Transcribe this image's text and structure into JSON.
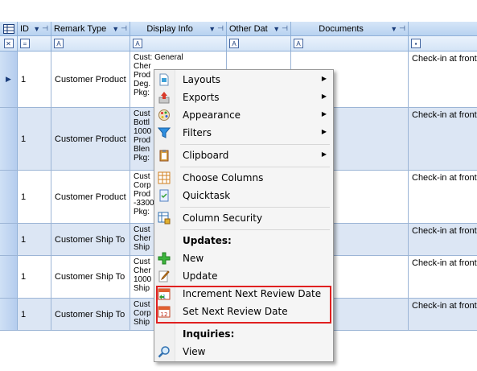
{
  "columns": {
    "id": "ID",
    "remark_type": "Remark Type",
    "display_info": "Display Info",
    "other_data": "Other Dat",
    "documents": "Documents"
  },
  "filter_row": {
    "id_op": "=",
    "text_icon": "A"
  },
  "rows": [
    {
      "id": "1",
      "remark_type": "Customer Product",
      "display": [
        "Cust: General",
        "Cher",
        "Prod",
        "Deg.",
        "Pkg:"
      ],
      "note": "Check-in at front"
    },
    {
      "id": "1",
      "remark_type": "Customer Product",
      "display": [
        "Cust",
        "Bottl",
        "1000",
        "Prod",
        "Blen",
        "Pkg:"
      ],
      "note": "Check-in at front"
    },
    {
      "id": "1",
      "remark_type": "Customer Product",
      "display": [
        "Cust",
        "Corp",
        "Prod",
        "-3300",
        "Pkg:"
      ],
      "note": "Check-in at front"
    },
    {
      "id": "1",
      "remark_type": "Customer Ship To",
      "display": [
        "Cust",
        "Cher",
        "Ship"
      ],
      "note": "Check-in at front"
    },
    {
      "id": "1",
      "remark_type": "Customer Ship To",
      "display": [
        "Cust",
        "Cher",
        "1000",
        "Ship"
      ],
      "note": "Check-in at front"
    },
    {
      "id": "1",
      "remark_type": "Customer Ship To",
      "display": [
        "Cust",
        "Corp",
        "Ship"
      ],
      "note": "Check-in at front"
    }
  ],
  "context_menu": {
    "layouts": "Layouts",
    "exports": "Exports",
    "appearance": "Appearance",
    "filters": "Filters",
    "clipboard": "Clipboard",
    "choose_columns": "Choose Columns",
    "quicktask": "Quicktask",
    "column_security": "Column Security",
    "updates_header": "Updates:",
    "new": "New",
    "update": "Update",
    "increment_next_review": "Increment Next Review Date",
    "set_next_review": "Set Next Review Date",
    "inquiries_header": "Inquiries:",
    "view": "View"
  },
  "colors": {
    "highlight_box": "#e02020",
    "header_blue": "#b8d2f0",
    "alt_row": "#dce6f4"
  }
}
